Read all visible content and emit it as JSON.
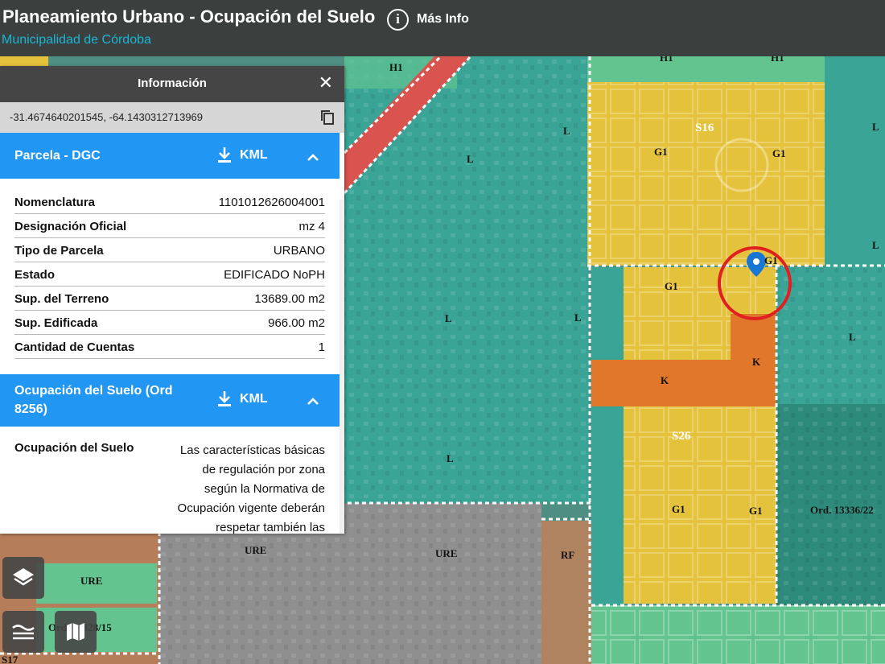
{
  "header": {
    "title": "Planeamiento Urbano - Ocupación del Suelo",
    "subtitle": "Municipalidad de Córdoba",
    "info_icon": "info-circle-icon",
    "info_label": "Más Info"
  },
  "panel": {
    "title": "Información",
    "coords": "-31.4674640201545, -64.1430312713969",
    "sections": [
      {
        "title": "Parcela - DGC",
        "kml_label": "KML",
        "rows": [
          {
            "key": "Nomenclatura",
            "value": "1101012626004001"
          },
          {
            "key": "Designación Oficial",
            "value": "mz 4"
          },
          {
            "key": "Tipo de Parcela",
            "value": "URBANO"
          },
          {
            "key": "Estado",
            "value": "EDIFICADO NoPH"
          },
          {
            "key": "Sup. del Terreno",
            "value": "13689.00 m2"
          },
          {
            "key": "Sup. Edificada",
            "value": "966.00 m2"
          },
          {
            "key": "Cantidad de Cuentas",
            "value": "1"
          }
        ]
      },
      {
        "title": "Ocupación del Suelo (Ord 8256)",
        "kml_label": "KML",
        "key": "Ocupación del Suelo",
        "value": "Las características básicas de regulación por zona según la Normativa de Ocupación vigente deberán respetar también las"
      }
    ]
  },
  "map": {
    "zone_labels": {
      "h1_a": "H1",
      "h1_b": "H1",
      "h1_c": "H1",
      "s16": "S16",
      "s26": "S26",
      "s17": "S17",
      "g1_a": "G1",
      "g1_b": "G1",
      "g1_c": "G1",
      "g1_d": "G1",
      "g1_e": "G1",
      "g1_f": "G1",
      "k_a": "K",
      "k_b": "K",
      "l_a": "L",
      "l_b": "L",
      "l_c": "L",
      "l_d": "L",
      "l_e": "L",
      "l_f": "L",
      "l_g": "L",
      "l_h": "L",
      "ure_a": "URE",
      "ure_b": "URE",
      "ure_c": "URE",
      "rf": "RF",
      "ord_a": "Ord. 13336/22",
      "ord_b": "Ord. 13328/15"
    },
    "colors": {
      "L": "#3aa597",
      "G1": "#e5c23b",
      "K": "#e0772b",
      "H1": "#63c490",
      "URE": "#8f8f8f",
      "RF": "#c0805a",
      "road": "#d9534f",
      "marker": "#1976d2",
      "highlight_circle": "#e02020"
    }
  },
  "controls": {
    "layers_icon": "layers-icon",
    "legend_icon": "legend-icon",
    "basemap_icon": "map-icon"
  }
}
